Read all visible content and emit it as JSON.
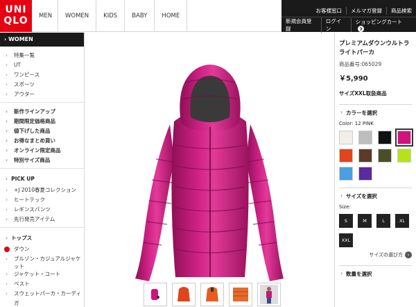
{
  "logo": {
    "line1": "UNI",
    "line2": "QLO"
  },
  "nav": [
    "MEN",
    "WOMEN",
    "KIDS",
    "BABY",
    "HOME"
  ],
  "util": {
    "row1": [
      "お客様窓口",
      "メルマガ登録",
      "商品検索"
    ],
    "row2": [
      "新規会員登録",
      "ログイン",
      "ショッピングカート"
    ]
  },
  "sidebar": {
    "header": "WOMEN",
    "group1": [
      "特集一覧",
      "UT",
      "ワンピース",
      "スポーツ",
      "アウター"
    ],
    "group2": [
      "新作ラインアップ",
      "期間限定価格商品",
      "値下げした商品",
      "お得なまとめ買い",
      "オンライン限定商品",
      "特別サイズ商品"
    ],
    "pickup_title": "PICK UP",
    "pickup": [
      "+J 2010春夏コレクション",
      "ヒートテック",
      "レギンスパンツ",
      "先行発売アイテム"
    ],
    "tops_title": "トップス",
    "tops": [
      "ダウン",
      "ブルゾン・カジュアルジャケット",
      "ジャケット・コート",
      "ベスト",
      "スウェットパーカ・カーディガ"
    ]
  },
  "product": {
    "name": "プレミアムダウンウルトラライトパーカ",
    "code": "商品番号:065029",
    "price": "￥5,990",
    "size_note": "サイズXXL取扱商品"
  },
  "color_section": {
    "title": "カラーを選択",
    "selected": "Color: 12 PINK",
    "swatches": [
      "#f3efe8",
      "#bdbdbd",
      "#111111",
      "#d1137e",
      "#e0451b",
      "#5a3b2a",
      "#4a4f2a",
      "#b6e21c",
      "#4a9fe0",
      "#5b2aa0"
    ]
  },
  "size_section": {
    "title": "サイズを選択",
    "label": "Size:",
    "sizes": [
      "S",
      "M",
      "L",
      "XL",
      "XXL"
    ],
    "guide": "サイズの選び方"
  },
  "qty_section": {
    "title": "数量を選択"
  },
  "colors": {
    "brand_red": "#e60012",
    "jacket_pink": "#c21a78"
  }
}
